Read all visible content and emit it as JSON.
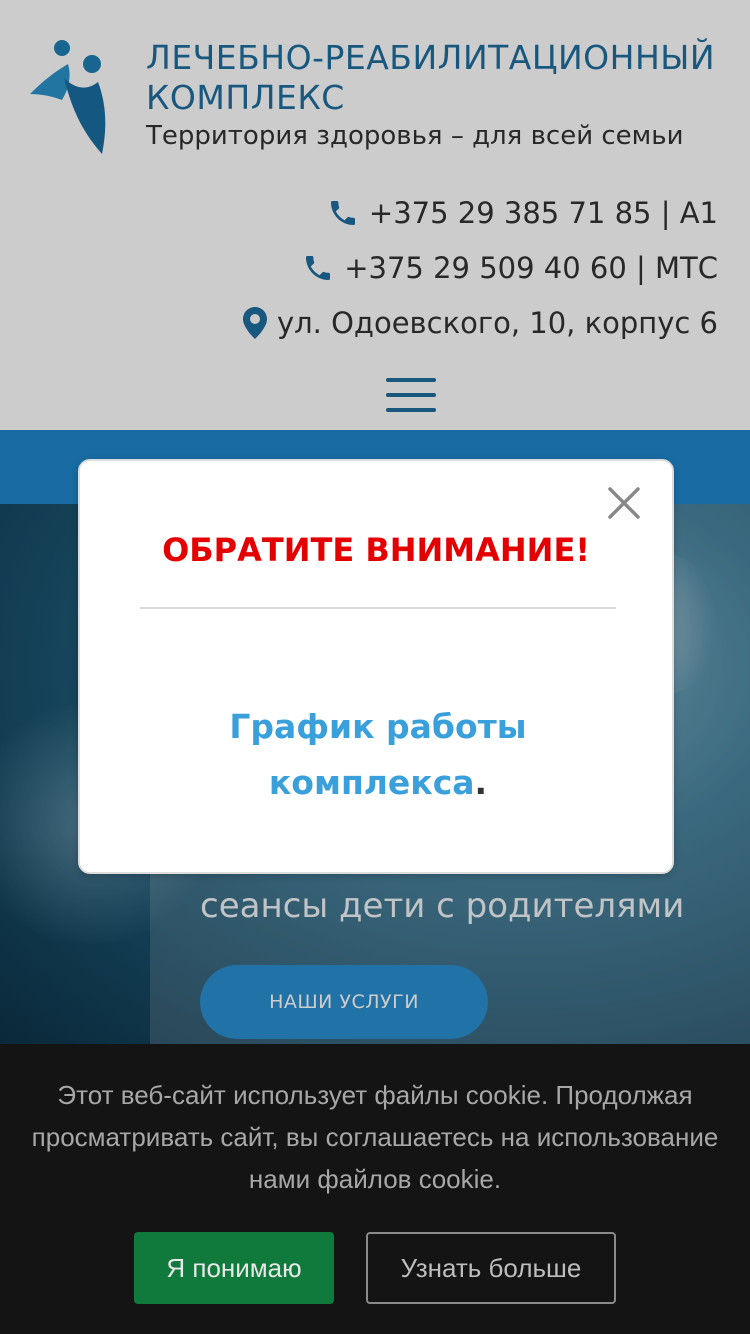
{
  "header": {
    "title": "ЛЕЧЕБНО-РЕАБИЛИТАЦИОННЫЙ КОМПЛЕКС",
    "tagline": "Территория здоровья – для всей семьи",
    "phones": [
      {
        "number": "+375 29 385 71 85 | A1",
        "icon": "phone-icon"
      },
      {
        "number": "+375 29 509 40 60 | МТС",
        "icon": "phone-icon"
      }
    ],
    "address": {
      "text": "ул. Одоевского, 10, корпус 6",
      "icon": "map-pin-icon"
    },
    "menu_icon": "hamburger-icon"
  },
  "hero": {
    "text": "сеансы дети с родителями",
    "button_label": "НАШИ УСЛУГИ"
  },
  "modal": {
    "title": "ОБРАТИТЕ ВНИМАНИЕ!",
    "link_text": "График работы комплекса",
    "trailing": ".",
    "close_icon": "close-icon"
  },
  "cookie": {
    "text": "Этот веб-сайт использует файлы cookie. Продолжая просматривать сайт, вы соглашаетесь на использование нами файлов cookie.",
    "accept_label": "Я понимаю",
    "more_label": "Узнать больше"
  },
  "colors": {
    "brand_blue": "#1f6d9e",
    "strip_blue": "#1e88cc",
    "alert_red": "#e40000",
    "link_blue": "#3aa0dc",
    "cookie_bg": "#141414",
    "accept_green": "#0f7a3c"
  }
}
